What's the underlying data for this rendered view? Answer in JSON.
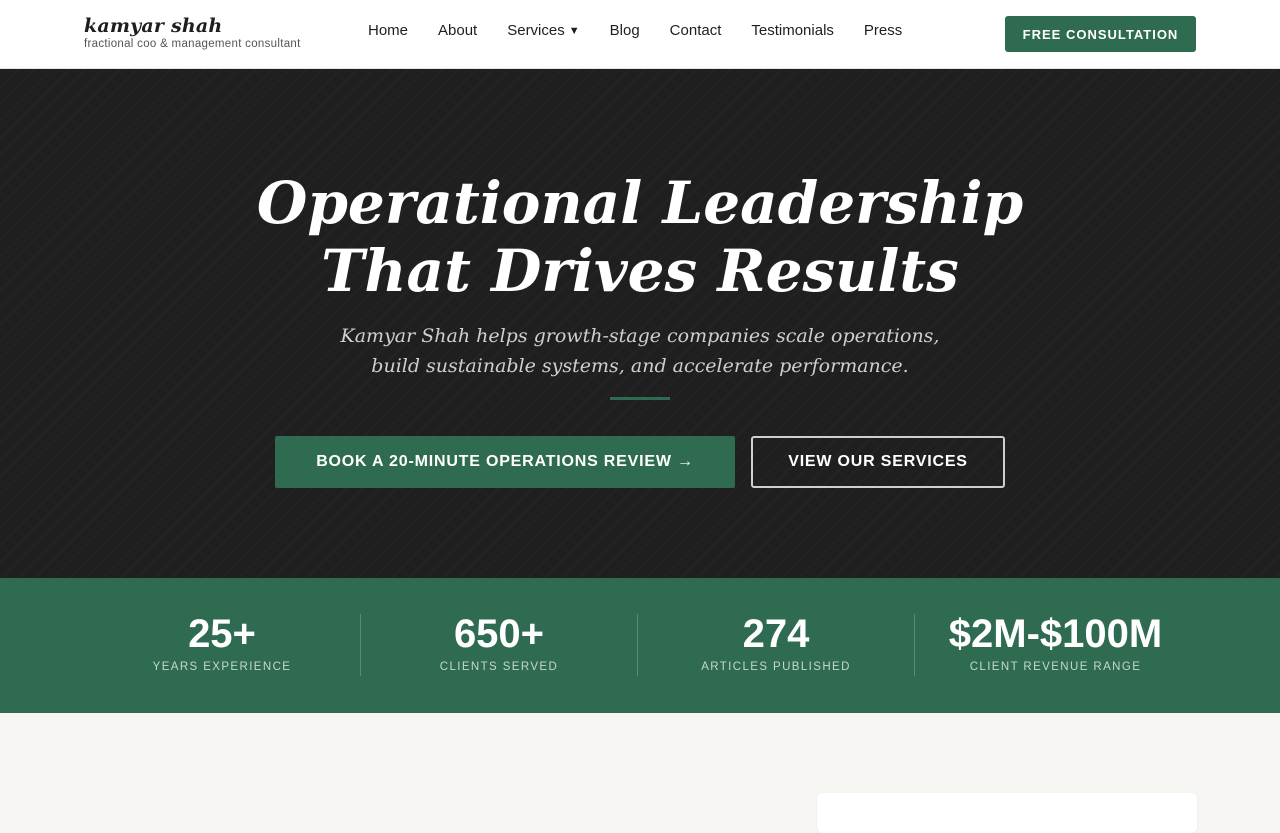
{
  "brand": {
    "name": "kamyar shah",
    "tagline": "fractional coo & management consultant"
  },
  "nav": {
    "items": [
      {
        "label": "Home"
      },
      {
        "label": "About"
      },
      {
        "label": "Services",
        "has_dropdown": true,
        "caret": "▼"
      },
      {
        "label": "Blog"
      },
      {
        "label": "Contact"
      },
      {
        "label": "Testimonials"
      },
      {
        "label": "Press"
      }
    ],
    "cta_label": "FREE CONSULTATION"
  },
  "hero": {
    "title_line1": "Operational Leadership",
    "title_line2": "That Drives Results",
    "subtitle_line1": "Kamyar Shah helps growth-stage companies scale operations,",
    "subtitle_line2": "build sustainable systems, and accelerate performance.",
    "primary_button": "BOOK A 20-MINUTE OPERATIONS REVIEW →",
    "secondary_button": "VIEW OUR SERVICES"
  },
  "stats": [
    {
      "value": "25+",
      "label": "YEARS EXPERIENCE"
    },
    {
      "value": "650+",
      "label": "CLIENTS SERVED"
    },
    {
      "value": "274",
      "label": "ARTICLES PUBLISHED"
    },
    {
      "value": "$2M-$100M",
      "label": "CLIENT REVENUE RANGE"
    }
  ],
  "colors": {
    "accent": "#2f6b50",
    "hero_bg": "#1f1f1f",
    "page_bg": "#f7f6f2"
  }
}
